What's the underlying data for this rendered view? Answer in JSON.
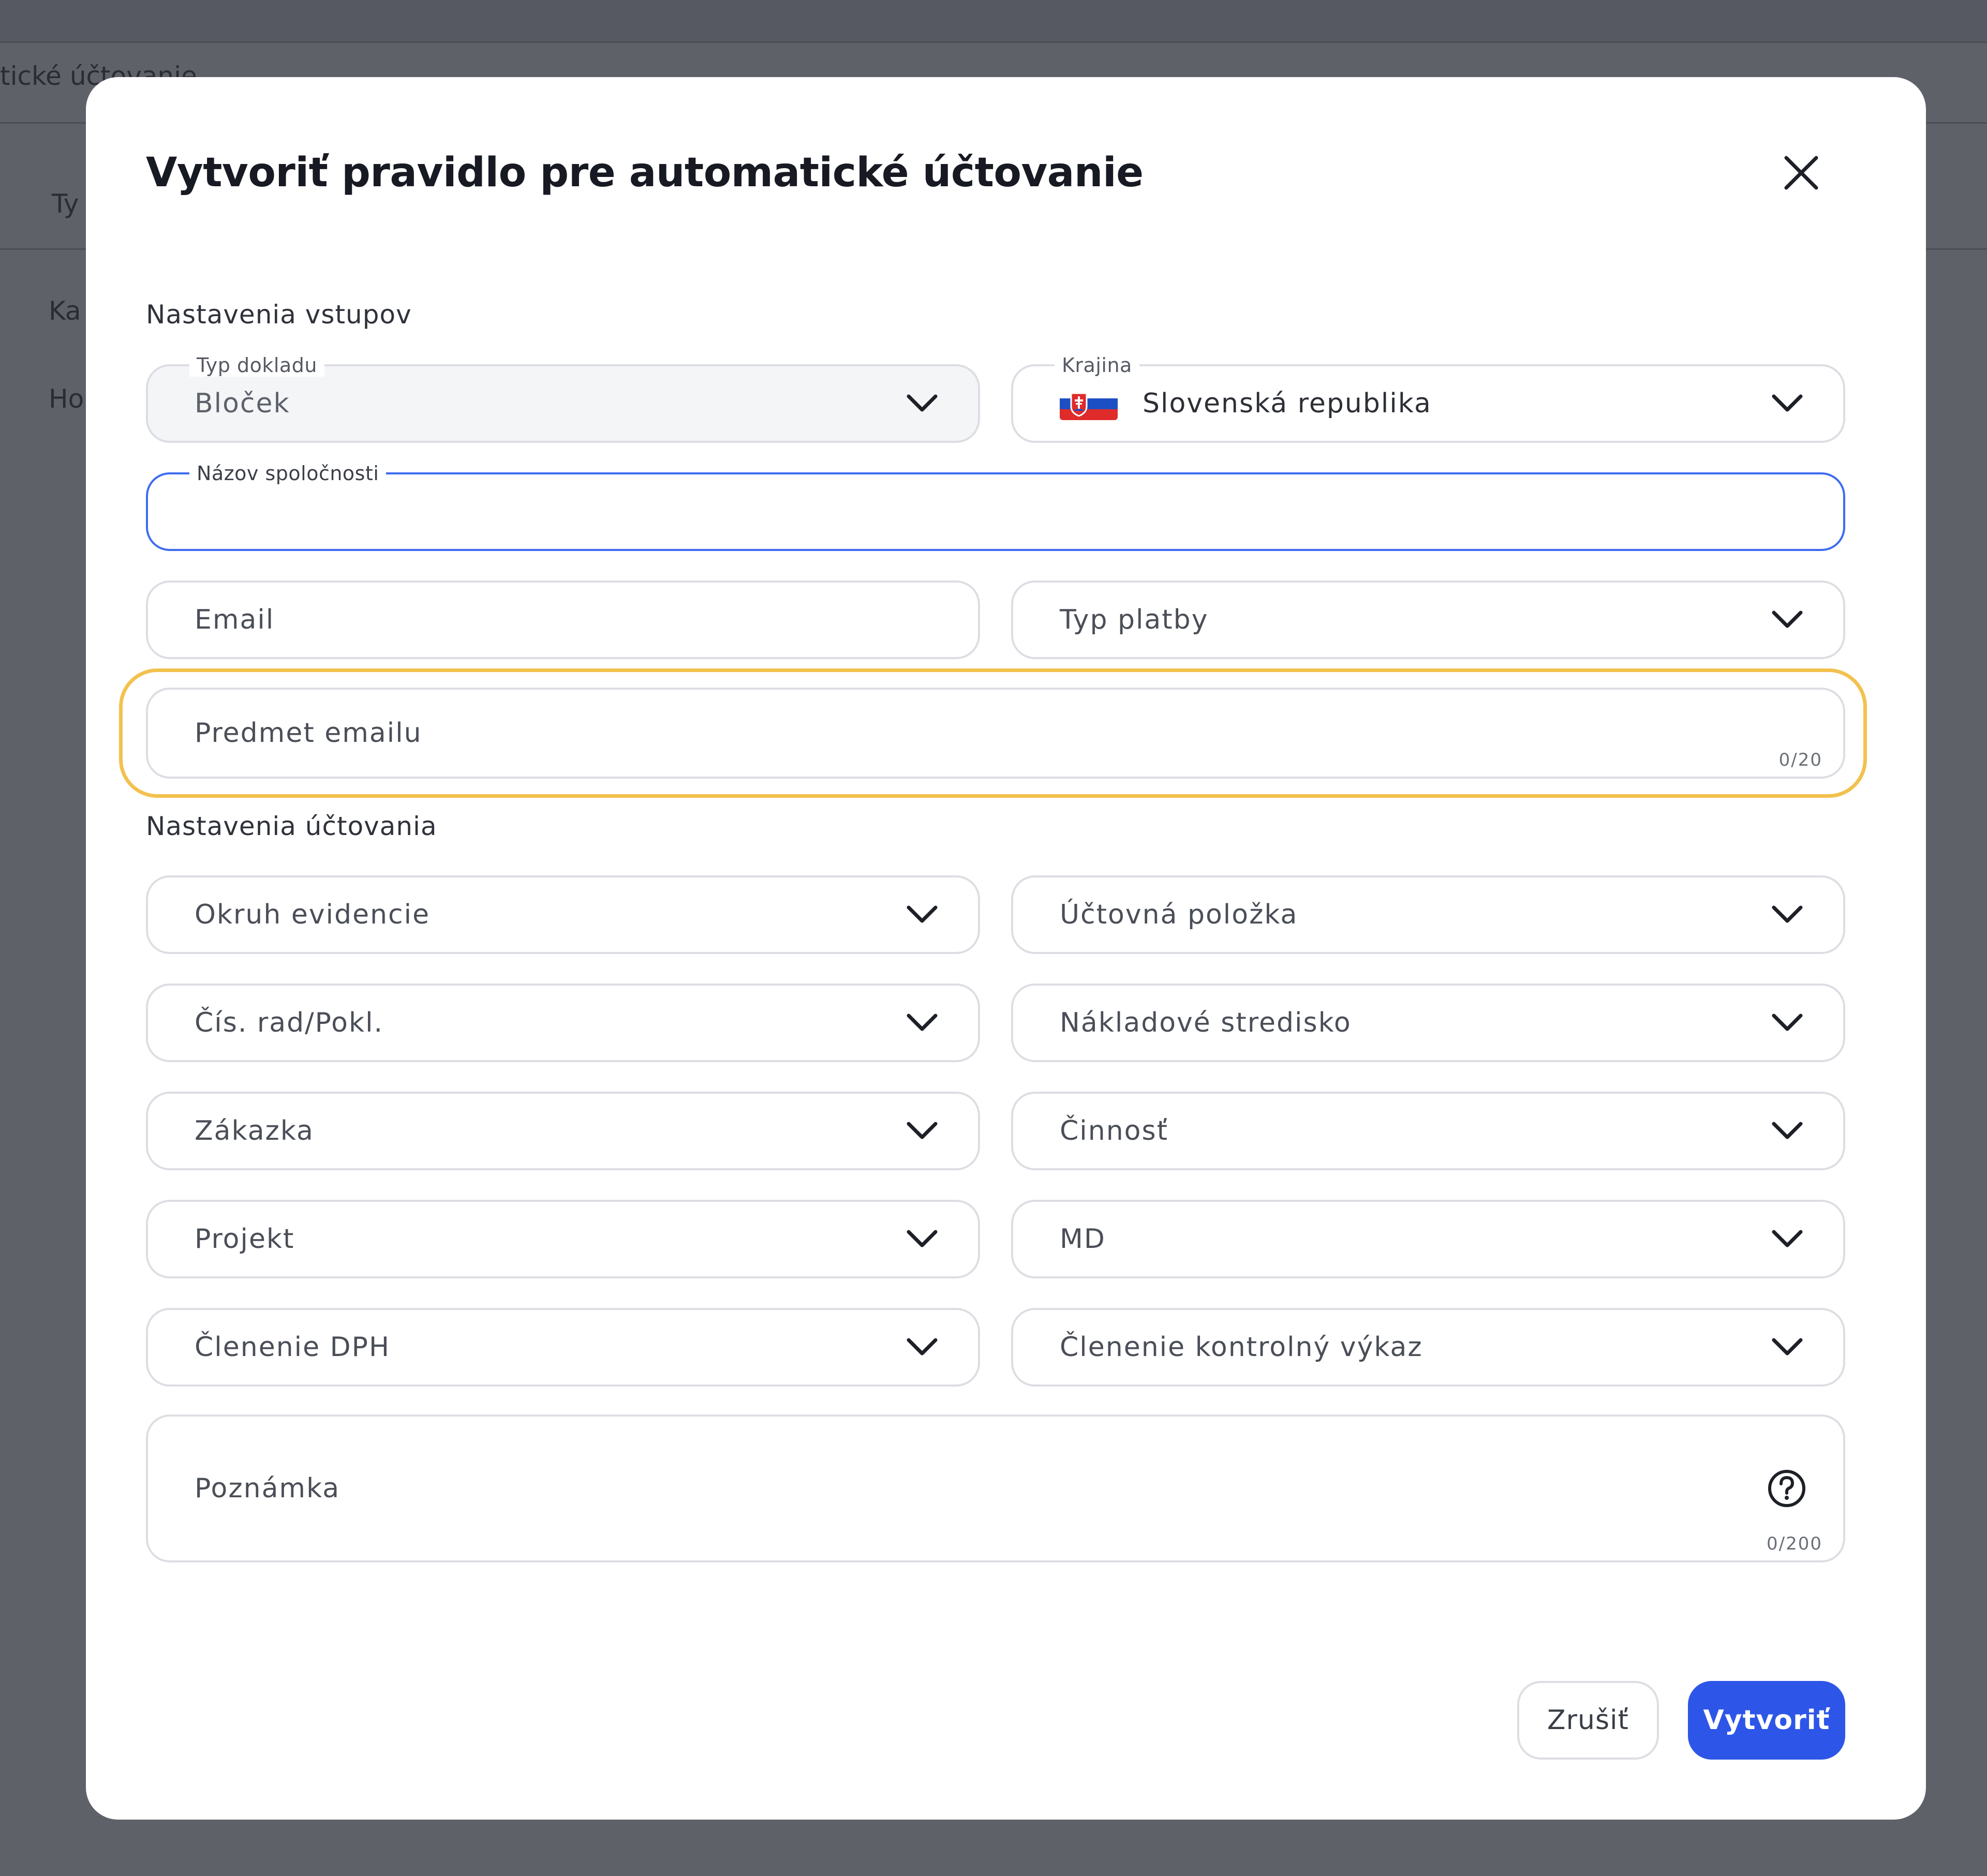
{
  "backdrop": {
    "header_text": "tické účtovanie",
    "row1_text": "Ty",
    "row2_text": "Ka",
    "row3_text": "Ho"
  },
  "modal": {
    "title": "Vytvoriť pravidlo pre automatické účtovanie",
    "close_icon": "close-icon"
  },
  "inputs_section": {
    "label": "Nastavenia vstupov",
    "document_type": {
      "label": "Typ dokladu",
      "value": "Bloček",
      "disabled": true
    },
    "country": {
      "label": "Krajina",
      "value": "Slovenská republika",
      "flag": "slovakia-flag-icon"
    },
    "company_name": {
      "label": "Názov spoločnosti",
      "value": "",
      "focused": true
    },
    "email": {
      "placeholder": "Email"
    },
    "payment_type": {
      "placeholder": "Typ platby"
    },
    "email_subject": {
      "placeholder": "Predmet emailu",
      "counter": "0/20"
    }
  },
  "accounting_section": {
    "label": "Nastavenia účtovania",
    "selects_left": [
      "Okruh evidencie",
      "Čís. rad/Pokl.",
      "Zákazka",
      "Projekt",
      "Členenie DPH"
    ],
    "selects_right": [
      "Účtovná položka",
      "Nákladové stredisko",
      "Činnosť",
      "MD",
      "Členenie kontrolný výkaz"
    ],
    "note": {
      "placeholder": "Poznámka",
      "counter": "0/200",
      "icon": "help-icon"
    }
  },
  "footer": {
    "cancel_label": "Zrušiť",
    "create_label": "Vytvoriť"
  },
  "colors": {
    "primary": "#2d56e8",
    "focus_border": "#3d6bf0",
    "highlight": "#f2c14e",
    "overlay": "#5f6169"
  }
}
